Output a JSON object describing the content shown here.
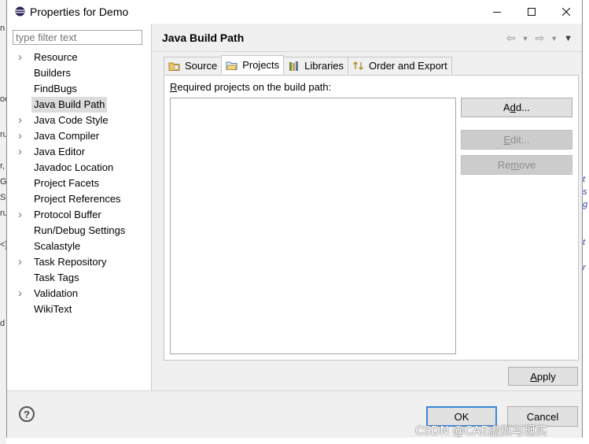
{
  "window": {
    "title": "Properties for Demo",
    "minimize": "—",
    "maximize": "☐",
    "close": "✕"
  },
  "filter": {
    "placeholder": "type filter text"
  },
  "tree": [
    {
      "label": "Resource",
      "expandable": true
    },
    {
      "label": "Builders",
      "expandable": false
    },
    {
      "label": "FindBugs",
      "expandable": false
    },
    {
      "label": "Java Build Path",
      "expandable": false,
      "selected": true
    },
    {
      "label": "Java Code Style",
      "expandable": true
    },
    {
      "label": "Java Compiler",
      "expandable": true
    },
    {
      "label": "Java Editor",
      "expandable": true
    },
    {
      "label": "Javadoc Location",
      "expandable": false
    },
    {
      "label": "Project Facets",
      "expandable": false
    },
    {
      "label": "Project References",
      "expandable": false
    },
    {
      "label": "Protocol Buffer",
      "expandable": true
    },
    {
      "label": "Run/Debug Settings",
      "expandable": false
    },
    {
      "label": "Scalastyle",
      "expandable": false
    },
    {
      "label": "Task Repository",
      "expandable": true
    },
    {
      "label": "Task Tags",
      "expandable": false
    },
    {
      "label": "Validation",
      "expandable": true
    },
    {
      "label": "WikiText",
      "expandable": false
    }
  ],
  "page": {
    "title": "Java Build Path"
  },
  "tabs": [
    {
      "label": "Source",
      "icon": "source-folder-icon"
    },
    {
      "label": "Projects",
      "icon": "projects-icon",
      "active": true
    },
    {
      "label": "Libraries",
      "icon": "libraries-icon"
    },
    {
      "label": "Order and Export",
      "icon": "order-export-icon"
    }
  ],
  "projects": {
    "label_pre": "R",
    "label_rest": "equired projects on the build path:",
    "items": []
  },
  "side_buttons": {
    "add": {
      "pre": "A",
      "mn": "d",
      "post": "d..."
    },
    "edit": {
      "pre": "",
      "mn": "E",
      "post": "dit..."
    },
    "remove": {
      "pre": "Re",
      "mn": "m",
      "post": "ove"
    }
  },
  "apply": {
    "pre": "",
    "mn": "A",
    "post": "pply"
  },
  "ok_label": "OK",
  "cancel_label": "Cancel",
  "watermark": "CSDN @CAE虚拟与现实",
  "colors": {
    "accent": "#3a86d6",
    "selected_bg": "#dcdcdc",
    "dialog_bg": "#f0f0f0"
  }
}
